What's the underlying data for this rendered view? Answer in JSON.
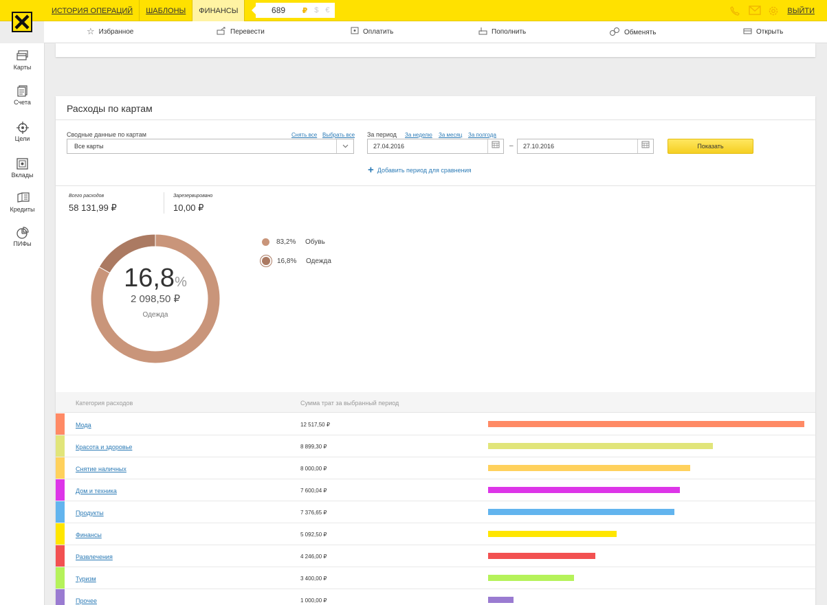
{
  "topbar": {
    "tabs": [
      {
        "label": "ИСТОРИЯ ОПЕРАЦИЙ"
      },
      {
        "label": "ШАБЛОНЫ"
      },
      {
        "label": "ФИНАНСЫ"
      }
    ],
    "balance": "689",
    "currencies": [
      "₽",
      "$",
      "€"
    ],
    "exit_label": "ВЫЙТИ",
    "brand_color": "#ffe100"
  },
  "actions": [
    {
      "label": "Избранное",
      "icon": "star-icon"
    },
    {
      "label": "Перевести",
      "icon": "transfer-icon"
    },
    {
      "label": "Оплатить",
      "icon": "pay-icon"
    },
    {
      "label": "Пополнить",
      "icon": "top-up-icon"
    },
    {
      "label": "Обменять",
      "icon": "exchange-icon"
    },
    {
      "label": "Открыть",
      "icon": "open-icon"
    }
  ],
  "sidebar": {
    "items": [
      {
        "label": "Карты",
        "icon": "card-icon"
      },
      {
        "label": "Счета",
        "icon": "accounts-icon"
      },
      {
        "label": "Цели",
        "icon": "target-icon"
      },
      {
        "label": "Вклады",
        "icon": "safe-icon"
      },
      {
        "label": "Кредиты",
        "icon": "credit-icon"
      },
      {
        "label": "ПИФы",
        "icon": "pie-icon"
      }
    ]
  },
  "card": {
    "title": "Расходы по картам",
    "summary_label": "Сводные данные по картам",
    "clear_all": "Снять все",
    "select_all": "Выбрать все",
    "cards_select_value": "Все карты",
    "period_label": "За период",
    "period_week": "За неделю",
    "period_month": "За месяц",
    "period_halfyear": "За полгода",
    "date_from": "27.04.2016",
    "date_to": "27.10.2016",
    "dash": "–",
    "show_button": "Показать",
    "add_period": "Добавить период для сравнения"
  },
  "totals": {
    "spent_label": "Всего расходов",
    "spent_value": "58 131,99 ₽",
    "reserved_label": "Зарезервировано",
    "reserved_value": "10,00 ₽"
  },
  "chart_data": {
    "type": "pie",
    "series": [
      {
        "name": "Обувь",
        "value": 83.2,
        "label": "83,2%",
        "color": "#c9957a"
      },
      {
        "name": "Одежда",
        "value": 16.8,
        "label": "16,8%",
        "color": "#ab7a62"
      }
    ],
    "center": {
      "percent": "16,8",
      "percent_sign": "%",
      "amount": "2 098,50 ₽",
      "category": "Одежда"
    }
  },
  "table": {
    "col_category": "Категория расходов",
    "col_sum": "Сумма трат за выбранный период",
    "max_value": 12517.5,
    "rows": [
      {
        "category": "Мода",
        "amount": "12 517,50 ₽",
        "value": 12517.5,
        "color": "#ff8a65"
      },
      {
        "category": "Красота и здоровье",
        "amount": "8 899,30 ₽",
        "value": 8899.3,
        "color": "#e1e57a"
      },
      {
        "category": "Снятие наличных",
        "amount": "8 000,00 ₽",
        "value": 8000.0,
        "color": "#ffd15c"
      },
      {
        "category": "Дом и техника",
        "amount": "7 600,04 ₽",
        "value": 7600.04,
        "color": "#dd35e8"
      },
      {
        "category": "Продукты",
        "amount": "7 376,65 ₽",
        "value": 7376.65,
        "color": "#62b4ee"
      },
      {
        "category": "Финансы",
        "amount": "5 092,50 ₽",
        "value": 5092.5,
        "color": "#ffe600"
      },
      {
        "category": "Развлечения",
        "amount": "4 246,00 ₽",
        "value": 4246.0,
        "color": "#f25151"
      },
      {
        "category": "Туризм",
        "amount": "3 400,00 ₽",
        "value": 3400.0,
        "color": "#b5f25a"
      },
      {
        "category": "Прочее",
        "amount": "1 000,00 ₽",
        "value": 1000.0,
        "color": "#9a7bd1"
      }
    ]
  }
}
